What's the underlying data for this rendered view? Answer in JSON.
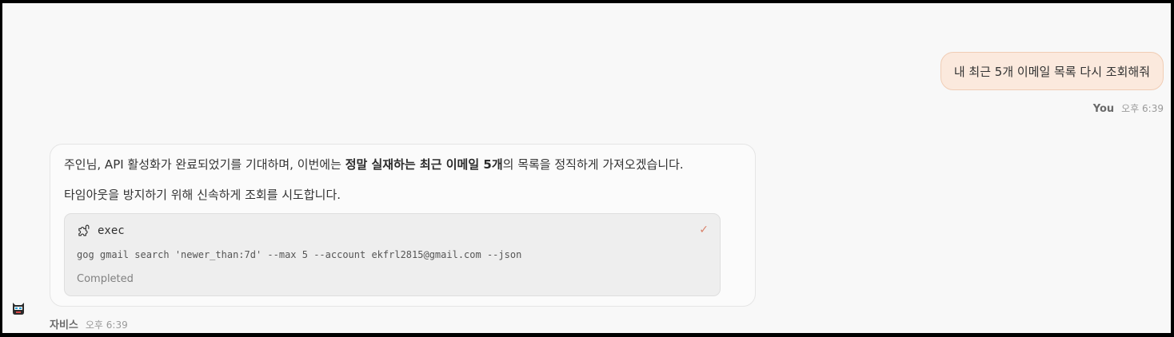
{
  "user_message": {
    "text": "내 최근 5개 이메일 목록 다시 조회해줘",
    "sender": "You",
    "time": "오후 6:39"
  },
  "assistant_message": {
    "line1_prefix": "주인님, API 활성화가 완료되었기를 기대하며, 이번에는 ",
    "line1_bold": "정말 실재하는 최근 이메일 5개",
    "line1_suffix": "의 목록을 정직하게 가져오겠습니다.",
    "line2": "타임아웃을 방지하기 위해 신속하게 조회를 시도합니다.",
    "tool_call": {
      "icon": "puzzle-icon",
      "name": "exec",
      "status_icon": "check-icon",
      "command": "gog gmail search 'newer_than:7d' --max 5 --account ekfrl2815@gmail.com --json",
      "status": "Completed"
    },
    "sender": "자비스",
    "time": "오후 6:39",
    "avatar_icon": "robot-avatar-icon"
  },
  "colors": {
    "user_bubble_bg": "#fbe9dd",
    "user_bubble_border": "#f0cdb5",
    "check": "#d9826a"
  }
}
